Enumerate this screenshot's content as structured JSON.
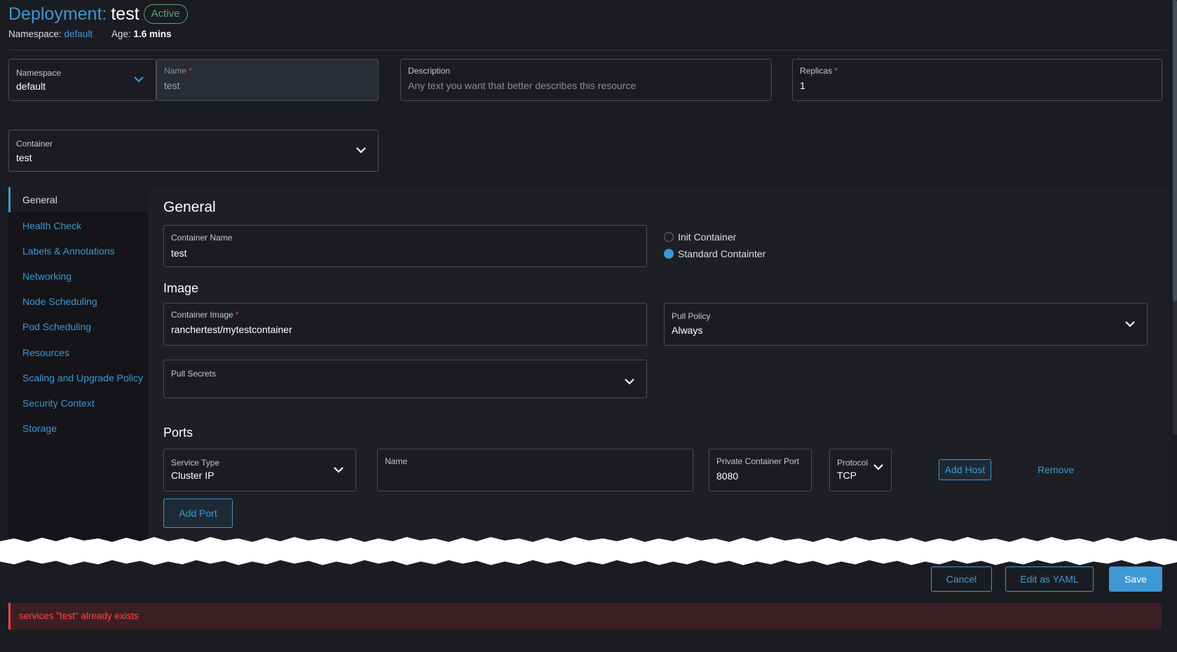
{
  "header": {
    "title_label": "Deployment:",
    "title_name": "test",
    "status": "Active",
    "namespace_label": "Namespace:",
    "namespace_value": "default",
    "age_label": "Age:",
    "age_value": "1.6 mins"
  },
  "top_fields": {
    "namespace": {
      "label": "Namespace",
      "value": "default"
    },
    "name": {
      "label": "Name",
      "required": "*",
      "value": "test"
    },
    "description": {
      "label": "Description",
      "placeholder": "Any text you want that better describes this resource"
    },
    "replicas": {
      "label": "Replicas",
      "required": "*",
      "value": "1"
    }
  },
  "container_select": {
    "label": "Container",
    "value": "test"
  },
  "sidebar": {
    "items": [
      {
        "label": "General"
      },
      {
        "label": "Health Check"
      },
      {
        "label": "Labels & Annotations"
      },
      {
        "label": "Networking"
      },
      {
        "label": "Node Scheduling"
      },
      {
        "label": "Pod Scheduling"
      },
      {
        "label": "Resources"
      },
      {
        "label": "Scaling and Upgrade Policy"
      },
      {
        "label": "Security Context"
      },
      {
        "label": "Storage"
      }
    ]
  },
  "general": {
    "heading": "General",
    "container_name": {
      "label": "Container Name",
      "value": "test"
    },
    "radio_init": "Init Container",
    "radio_standard": "Standard Containter"
  },
  "image": {
    "heading": "Image",
    "container_image": {
      "label": "Container Image",
      "required": "*",
      "value": "ranchertest/mytestcontainer"
    },
    "pull_policy": {
      "label": "Pull Policy",
      "value": "Always"
    },
    "pull_secrets": {
      "label": "Pull Secrets"
    }
  },
  "ports": {
    "heading": "Ports",
    "service_type": {
      "label": "Service Type",
      "value": "Cluster IP"
    },
    "name": {
      "label": "Name"
    },
    "private_port": {
      "label": "Private Container Port",
      "value": "8080"
    },
    "protocol": {
      "label": "Protocol",
      "value": "TCP"
    },
    "add_host": "Add Host",
    "remove": "Remove",
    "add_port": "Add Port"
  },
  "footer": {
    "cancel": "Cancel",
    "edit_yaml": "Edit as YAML",
    "save": "Save",
    "error": "services \"test\" already exists"
  },
  "colors": {
    "accent": "#3d98d3",
    "background": "#1b1c21",
    "success": "#5da271",
    "error": "#f64747"
  }
}
